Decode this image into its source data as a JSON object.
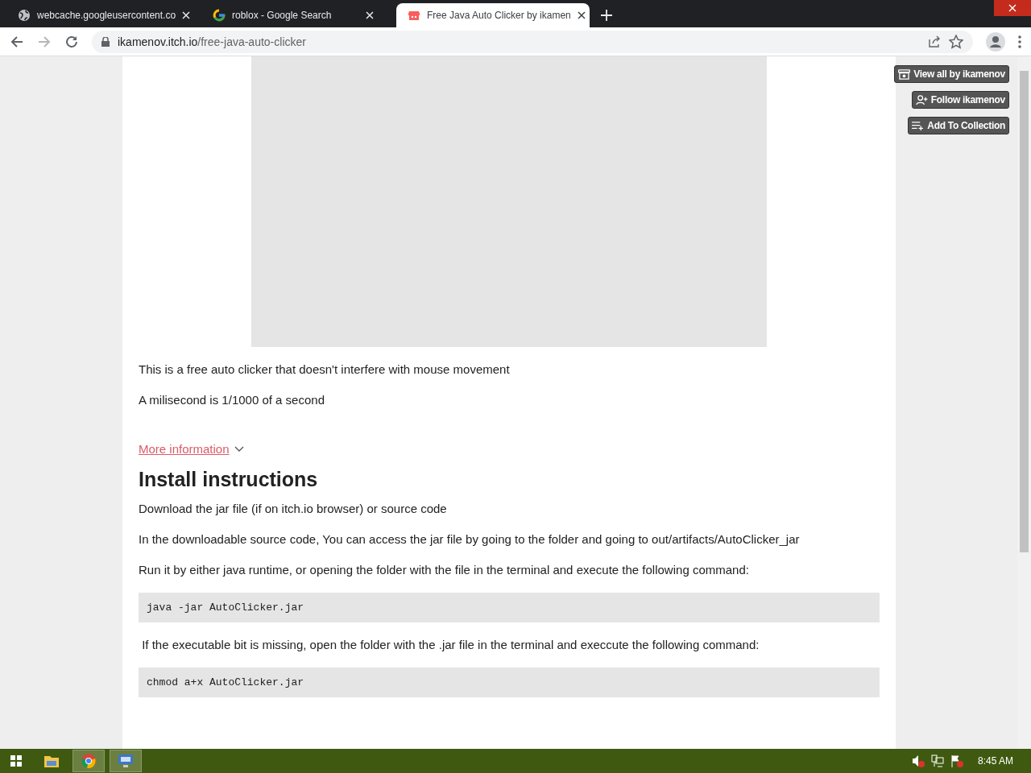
{
  "browser": {
    "tabs": [
      {
        "title": "webcache.googleusercontent.co",
        "kind": "globe",
        "selected": false
      },
      {
        "title": "roblox - Google Search",
        "kind": "google",
        "selected": false
      },
      {
        "title": "Free Java Auto Clicker by ikamen",
        "kind": "itch",
        "selected": true
      }
    ],
    "address": {
      "host": "ikamenov.itch.io",
      "path": "/free-java-auto-clicker"
    }
  },
  "sidebar_buttons": [
    {
      "label": "View all by ikamenov",
      "kind": "store"
    },
    {
      "label": "Follow ikamenov",
      "kind": "follow"
    },
    {
      "label": "Add To Collection",
      "kind": "collection"
    }
  ],
  "content": [
    {
      "kind": "paragraph",
      "text": "This is a free auto clicker that doesn't interfere with mouse movement"
    },
    {
      "kind": "paragraph",
      "text": "A milisecond is 1/1000 of a second"
    },
    {
      "kind": "link",
      "text": "More information"
    },
    {
      "kind": "heading",
      "text": "Install instructions"
    },
    {
      "kind": "paragraph",
      "text": "Download the jar file (if on itch.io browser) or source code"
    },
    {
      "kind": "paragraph",
      "text": "In the downloadable source code, You can access the jar file by going to the folder and going to out/artifacts/AutoClicker_jar"
    },
    {
      "kind": "paragraph",
      "text": "Run it by either java runtime, or opening the folder with the file in the terminal and execute the following command:"
    },
    {
      "kind": "code",
      "text": "java -jar AutoClicker.jar"
    },
    {
      "kind": "paragraph",
      "text": " If the executable bit is missing, open the folder with the .jar file in the terminal and execcute the following command:"
    },
    {
      "kind": "code",
      "text": "chmod a+x AutoClicker.jar"
    }
  ],
  "taskbar": {
    "time": "8:45 AM"
  }
}
